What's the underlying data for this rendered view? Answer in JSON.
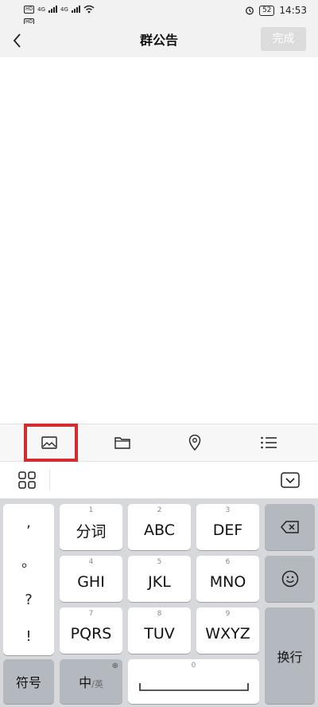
{
  "status_bar": {
    "badge1": "HD",
    "badge2": "HD",
    "net1": "4G",
    "net2": "4G",
    "battery": "52",
    "time": "14:53"
  },
  "nav": {
    "title": "群公告",
    "done_label": "完成"
  },
  "toolbar": {
    "items": [
      {
        "icon": "image-icon"
      },
      {
        "icon": "folder-icon"
      },
      {
        "icon": "location-pin-icon"
      },
      {
        "icon": "list-icon"
      }
    ],
    "highlight_color": "#d42b2b"
  },
  "keyboard": {
    "punct": [
      ",",
      "。",
      "?",
      "!"
    ],
    "keys": [
      {
        "num": "1",
        "label": "分词"
      },
      {
        "num": "2",
        "label": "ABC"
      },
      {
        "num": "3",
        "label": "DEF"
      },
      {
        "num": "4",
        "label": "GHI"
      },
      {
        "num": "5",
        "label": "JKL"
      },
      {
        "num": "6",
        "label": "MNO"
      },
      {
        "num": "7",
        "label": "PQRS"
      },
      {
        "num": "8",
        "label": "TUV"
      },
      {
        "num": "9",
        "label": "WXYZ"
      }
    ],
    "symbol_label": "符号",
    "lang_main": "中",
    "lang_alt": "/英",
    "space_num": "0",
    "enter_label": "换行"
  }
}
